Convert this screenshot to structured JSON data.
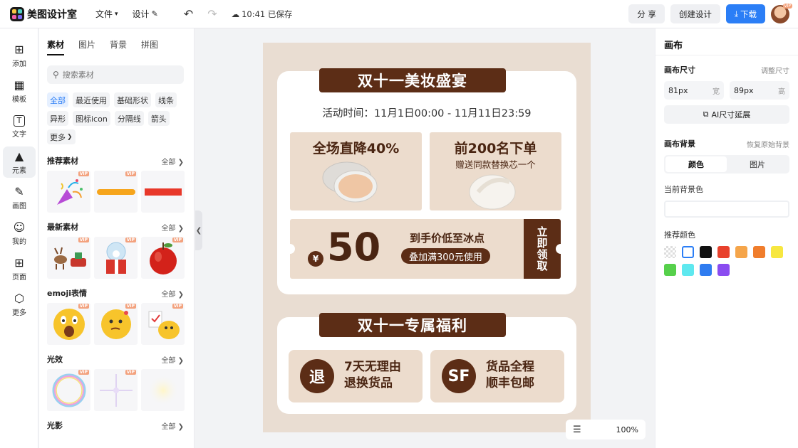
{
  "app": {
    "name": "美图设计室"
  },
  "menu": {
    "file": "文件",
    "design": "设计",
    "saved_time": "10:41 已保存"
  },
  "top_actions": {
    "share": "分 享",
    "create": "创建设计",
    "download": "下载"
  },
  "avatar_badge": "VIP",
  "rail": [
    {
      "label": "添加",
      "icon": "plus-square-icon"
    },
    {
      "label": "模板",
      "icon": "template-icon"
    },
    {
      "label": "文字",
      "icon": "text-icon"
    },
    {
      "label": "元素",
      "icon": "shapes-icon",
      "active": true
    },
    {
      "label": "画图",
      "icon": "draw-icon"
    },
    {
      "label": "我的",
      "icon": "user-icon"
    },
    {
      "label": "页面",
      "icon": "add-page-icon"
    },
    {
      "label": "更多",
      "icon": "cube-icon"
    }
  ],
  "panel": {
    "tabs": [
      "素材",
      "图片",
      "背景",
      "拼图"
    ],
    "search_placeholder": "搜索素材",
    "chips": [
      "全部",
      "最近使用",
      "基础形状",
      "线条",
      "异形",
      "图标icon",
      "分隔线",
      "箭头",
      "更多"
    ],
    "vip": "VIP",
    "all_label": "全部",
    "sections": [
      {
        "title": "推荐素材",
        "items": [
          "party-popper",
          "yellow-stroke",
          "red-bar"
        ]
      },
      {
        "title": "最新素材",
        "items": [
          "reindeer-sleigh",
          "snow-globe-gift",
          "red-apple"
        ]
      },
      {
        "title": "emoji表情",
        "items": [
          "shocked-face",
          "thinking-face",
          "chick-checklist"
        ]
      },
      {
        "title": "光效",
        "items": [
          "rainbow-bubble",
          "sparkle-star",
          "glow"
        ]
      },
      {
        "title": "光影",
        "items": []
      }
    ]
  },
  "poster": {
    "bg": "#e9ddd2",
    "accent": "#5c2d16",
    "banner1": "双十一美妆盛宴",
    "activity_time": "活动时间：11月1日00:00 - 11月11日23:59",
    "promo_left_title": "全场直降40%",
    "promo_right_title": "前200名下单",
    "promo_right_sub": "赠送同款替换芯一个",
    "coupon_yen": "¥",
    "coupon_amount": "50",
    "coupon_line1": "到手价低至冰点",
    "coupon_line2": "叠加满300元使用",
    "coupon_claim": "立即领取",
    "banner2": "双十一专属福利",
    "benefit1_badge": "退",
    "benefit1_line1": "7天无理由",
    "benefit1_line2": "退换货品",
    "benefit2_badge": "SF",
    "benefit2_line1": "货品全程",
    "benefit2_line2": "顺丰包邮"
  },
  "zoom": "100%",
  "right_panel": {
    "title": "画布",
    "size_label": "画布尺寸",
    "adjust_size": "调整尺寸",
    "width_value": "81px",
    "width_unit": "宽",
    "height_value": "89px",
    "height_unit": "高",
    "ai_extend": "AI尺寸延展",
    "bg_label": "画布背景",
    "restore_bg": "恢复原始背景",
    "seg_color": "颜色",
    "seg_image": "图片",
    "current_bg": "当前背景色",
    "recommend_colors": "推荐颜色",
    "swatches": [
      "transparent",
      "#ffffff",
      "#111111",
      "#e8412c",
      "#f5a54a",
      "#f07d2c",
      "#f7e740",
      "#56d04b",
      "#5ee8ef",
      "#2f7cf0",
      "#8a4cf0"
    ]
  }
}
